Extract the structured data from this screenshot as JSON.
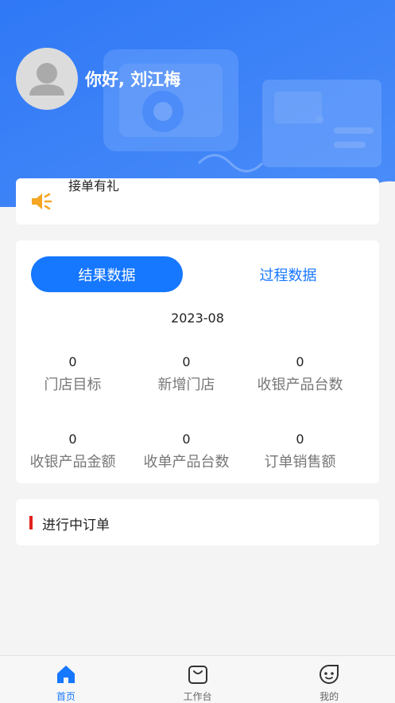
{
  "header": {
    "greeting": "你好, 刘江梅"
  },
  "notice": {
    "text": "接单有礼"
  },
  "stats": {
    "tabs": [
      {
        "label": "结果数据",
        "active": true
      },
      {
        "label": "过程数据",
        "active": false
      }
    ],
    "period": "2023-08",
    "metrics": [
      {
        "value": "0",
        "label": "门店目标"
      },
      {
        "value": "0",
        "label": "新增门店"
      },
      {
        "value": "0",
        "label": "收银产品台数"
      },
      {
        "value": "0",
        "label": "收银产品金额"
      },
      {
        "value": "0",
        "label": "收单产品台数"
      },
      {
        "value": "0",
        "label": "订单销售额"
      }
    ]
  },
  "orders": {
    "title": "进行中订单"
  },
  "tabbar": {
    "items": [
      {
        "label": "首页",
        "icon": "home-icon",
        "active": true
      },
      {
        "label": "工作台",
        "icon": "bag-icon",
        "active": false
      },
      {
        "label": "我的",
        "icon": "face-icon",
        "active": false
      }
    ]
  },
  "colors": {
    "primary": "#1677ff",
    "header_blue": "#3b7cf5",
    "accent_red": "#e0221c",
    "notice_orange": "#f5a623"
  }
}
